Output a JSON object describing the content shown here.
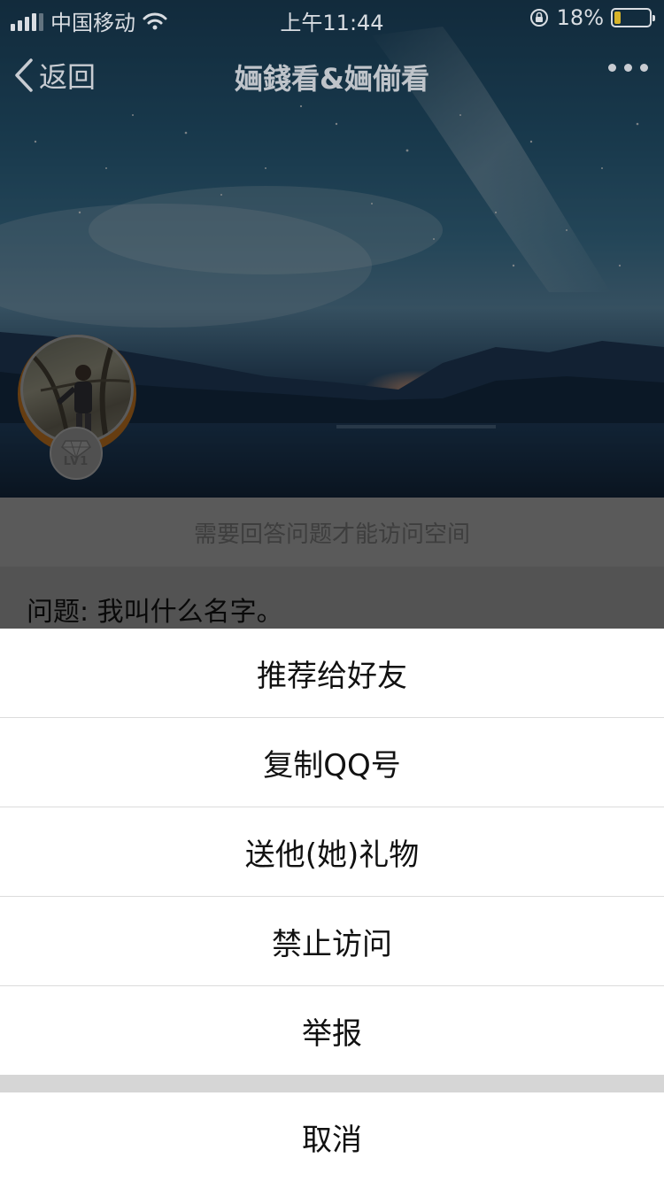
{
  "status_bar": {
    "carrier": "中国移动",
    "time": "上午11:44",
    "battery_percent": "18%",
    "battery_level": 0.18,
    "battery_color": "#d7b42a"
  },
  "nav": {
    "back_label": "返回",
    "title": "婳錢看&婳偂看"
  },
  "profile": {
    "level_label": "LV1"
  },
  "question_section": {
    "notice": "需要回答问题才能访问空间",
    "question": "问题: 我叫什么名字。"
  },
  "action_sheet": {
    "items": [
      {
        "label": "推荐给好友"
      },
      {
        "label": "复制QQ号"
      },
      {
        "label": "送他(她)礼物"
      },
      {
        "label": "禁止访问"
      },
      {
        "label": "举报"
      }
    ],
    "cancel_label": "取消"
  },
  "colors": {
    "sheet_background": "#ffffff",
    "sheet_separator": "#d6d6d6",
    "avatar_ring": "#b06a1e"
  }
}
